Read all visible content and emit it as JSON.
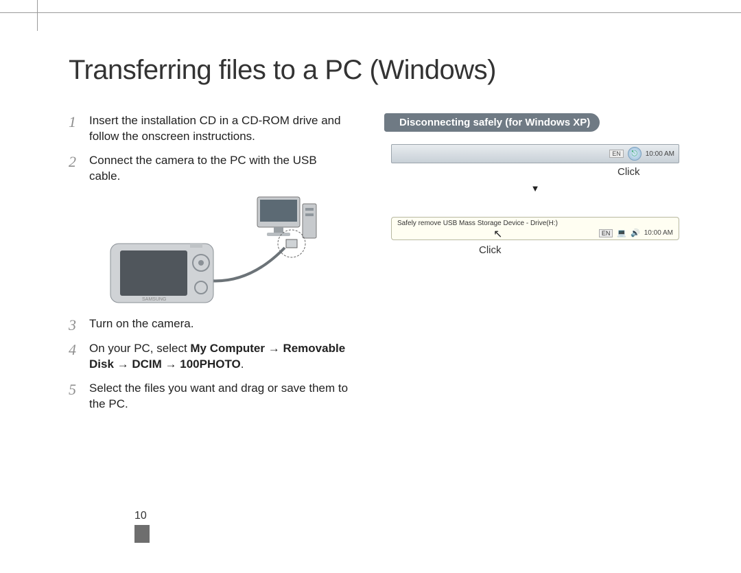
{
  "title": "Transferring files to a PC (Windows)",
  "steps": {
    "s1": {
      "num": "1",
      "text": "Insert the installation CD in a CD-ROM drive and follow the onscreen instructions."
    },
    "s2": {
      "num": "2",
      "text": "Connect the camera to the PC with the USB cable."
    },
    "s3": {
      "num": "3",
      "text": "Turn on the camera."
    },
    "s4": {
      "num": "4",
      "prefix": "On your PC, select ",
      "bold": "My Computer → Removable Disk → DCIM → 100PHOTO",
      "suffix": "."
    },
    "s5": {
      "num": "5",
      "text": "Select the files you want and drag or save them to the PC."
    }
  },
  "callout_title": "Disconnecting safely (for Windows XP)",
  "taskbar1": {
    "en": "EN",
    "time": "10:00 AM"
  },
  "click_label_1": "Click",
  "arrow": "▼",
  "balloon_text": "Safely remove USB Mass Storage Device - Drive(H:)",
  "taskbar2": {
    "en": "EN",
    "time": "10:00 AM"
  },
  "click_label_2": "Click",
  "page_number": "10"
}
